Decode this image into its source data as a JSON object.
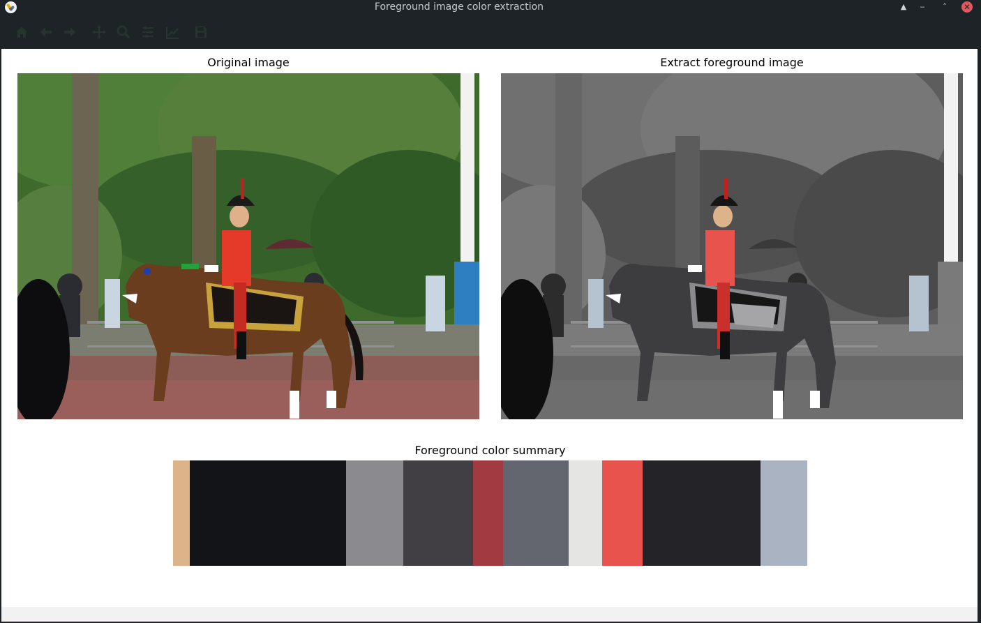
{
  "window": {
    "title": "Foreground image color extraction",
    "controls": {
      "shade": "▲",
      "minimize": "‒",
      "maximize": "˄",
      "close": "✕"
    }
  },
  "toolbar": {
    "tools": [
      "home-icon",
      "back-arrow-icon",
      "forward-arrow-icon",
      "pan-move-icon",
      "zoom-magnifier-icon",
      "configure-subplots-icon",
      "edit-axis-icon",
      "save-disk-icon"
    ]
  },
  "figure": {
    "left_title": "Original image",
    "right_title": "Extract foreground image",
    "summary_title": "Foreground color summary"
  },
  "colors": {
    "toolbar_icon": "#26332f",
    "titlebar": "#1d2326"
  },
  "swatches": [
    {
      "color": "#ddb48a",
      "share": 0.0264
    },
    {
      "color": "#131417",
      "share": 0.2464
    },
    {
      "color": "#8b8a8e",
      "share": 0.0902
    },
    {
      "color": "#413f44",
      "share": 0.11
    },
    {
      "color": "#a23a42",
      "share": 0.0473
    },
    {
      "color": "#64666f",
      "share": 0.1034
    },
    {
      "color": "#e5e6e3",
      "share": 0.0528
    },
    {
      "color": "#e9534e",
      "share": 0.0638
    },
    {
      "color": "#242327",
      "share": 0.1859
    },
    {
      "color": "#a9b3c1",
      "share": 0.0738
    }
  ]
}
